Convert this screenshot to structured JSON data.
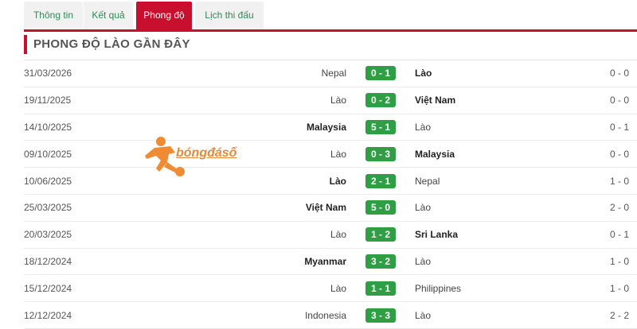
{
  "tabs": [
    {
      "label": "Thông tin"
    },
    {
      "label": "Kết quả"
    },
    {
      "label": "Phong độ"
    },
    {
      "label": "Lịch thi đấu"
    }
  ],
  "active_tab": "Phong độ",
  "section_title": "PHONG ĐỘ LÀO GẦN ĐÂY",
  "watermark_text": "bóngđásố",
  "matches": [
    {
      "date": "31/03/2026",
      "home": "Nepal",
      "score": "0 - 1",
      "away": "Lào",
      "ht": "0 - 0",
      "winner": "away"
    },
    {
      "date": "19/11/2025",
      "home": "Lào",
      "score": "0 - 2",
      "away": "Việt Nam",
      "ht": "0 - 0",
      "winner": "away"
    },
    {
      "date": "14/10/2025",
      "home": "Malaysia",
      "score": "5 - 1",
      "away": "Lào",
      "ht": "0 - 1",
      "winner": "home"
    },
    {
      "date": "09/10/2025",
      "home": "Lào",
      "score": "0 - 3",
      "away": "Malaysia",
      "ht": "0 - 0",
      "winner": "away"
    },
    {
      "date": "10/06/2025",
      "home": "Lào",
      "score": "2 - 1",
      "away": "Nepal",
      "ht": "1 - 0",
      "winner": "home"
    },
    {
      "date": "25/03/2025",
      "home": "Việt Nam",
      "score": "5 - 0",
      "away": "Lào",
      "ht": "2 - 0",
      "winner": "home"
    },
    {
      "date": "20/03/2025",
      "home": "Lào",
      "score": "1 - 2",
      "away": "Sri Lanka",
      "ht": "0 - 1",
      "winner": "away"
    },
    {
      "date": "18/12/2024",
      "home": "Myanmar",
      "score": "3 - 2",
      "away": "Lào",
      "ht": "1 - 0",
      "winner": "home"
    },
    {
      "date": "15/12/2024",
      "home": "Lào",
      "score": "1 - 1",
      "away": "Philippines",
      "ht": "1 - 0",
      "winner": "none"
    },
    {
      "date": "12/12/2024",
      "home": "Indonesia",
      "score": "3 - 3",
      "away": "Lào",
      "ht": "2 - 2",
      "winner": "none"
    }
  ],
  "colors": {
    "accent": "#c8102e",
    "score_bg": "#2f9e44",
    "tab_text": "#2e8b57"
  }
}
